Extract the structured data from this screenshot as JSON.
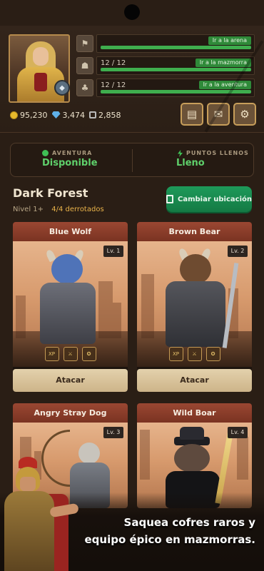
{
  "header": {
    "modes": [
      {
        "icon": "arena-icon",
        "count": "",
        "button": "Ir a la arena",
        "progress": 1.0
      },
      {
        "icon": "dungeon-icon",
        "count": "12 / 12",
        "button": "Ir a la mazmorra",
        "progress": 1.0
      },
      {
        "icon": "adventure-icon",
        "count": "12 / 12",
        "button": "Ir a la aventura",
        "progress": 1.0
      }
    ],
    "resources": {
      "gold": "95,230",
      "gems": "3,474",
      "tokens": "2,858"
    }
  },
  "status": {
    "adventure_label": "AVENTURA",
    "adventure_value": "Disponible",
    "points_label": "PUNTOS LLENOS",
    "points_value": "Lleno"
  },
  "location": {
    "name": "Dark Forest",
    "level": "Nivel 1+",
    "defeated": "4/4 derrotados",
    "change_button": "Cambiar ubicación"
  },
  "enemies": [
    {
      "name": "Blue Wolf",
      "level": "Lv. 1",
      "attack": "Atacar",
      "rewards": [
        "XP",
        "⚔",
        "✪"
      ]
    },
    {
      "name": "Brown Bear",
      "level": "Lv. 2",
      "attack": "Atacar",
      "rewards": [
        "XP",
        "⚔",
        "✪"
      ]
    },
    {
      "name": "Angry Stray Dog",
      "level": "Lv. 3"
    },
    {
      "name": "Wild Boar",
      "level": "Lv. 4"
    }
  ],
  "promo": {
    "line1": "Saquea cofres raros y",
    "line2": "equipo épico en mazmorras."
  },
  "colors": {
    "accent_green": "#2f8a39",
    "card_header": "#8a3d2a",
    "change_button": "#1a8a4f"
  }
}
